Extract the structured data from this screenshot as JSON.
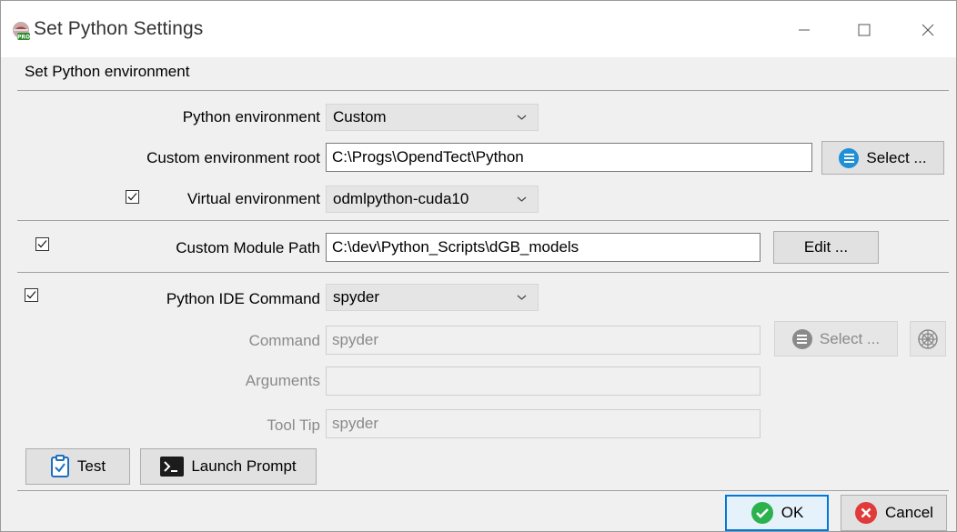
{
  "window": {
    "title": "Set Python Settings",
    "section_title": "Set Python environment"
  },
  "env": {
    "python_env_label": "Python environment",
    "python_env_value": "Custom",
    "custom_root_label": "Custom environment root",
    "custom_root_value": "C:\\Progs\\OpendTect\\Python",
    "select_button": "Select ...",
    "virtual_env_label": "Virtual environment",
    "virtual_env_checked": true,
    "virtual_env_value": "odmlpython-cuda10"
  },
  "module_path": {
    "checked": true,
    "label": "Custom Module Path",
    "value": "C:\\dev\\Python_Scripts\\dGB_models",
    "edit_button": "Edit ..."
  },
  "ide": {
    "checked": true,
    "label": "Python IDE Command",
    "value": "spyder",
    "command_label": "Command",
    "command_value": "spyder",
    "select_button": "Select ...",
    "arguments_label": "Arguments",
    "arguments_value": "",
    "tooltip_label": "Tool Tip",
    "tooltip_value": "spyder"
  },
  "actions": {
    "test_button": "Test",
    "launch_prompt_button": "Launch Prompt",
    "ok_button": "OK",
    "cancel_button": "Cancel"
  },
  "colors": {
    "accent": "#0078d7",
    "ok_green": "#2bb24c",
    "cancel_red": "#e03a3a",
    "select_blue": "#1f8fd6"
  }
}
